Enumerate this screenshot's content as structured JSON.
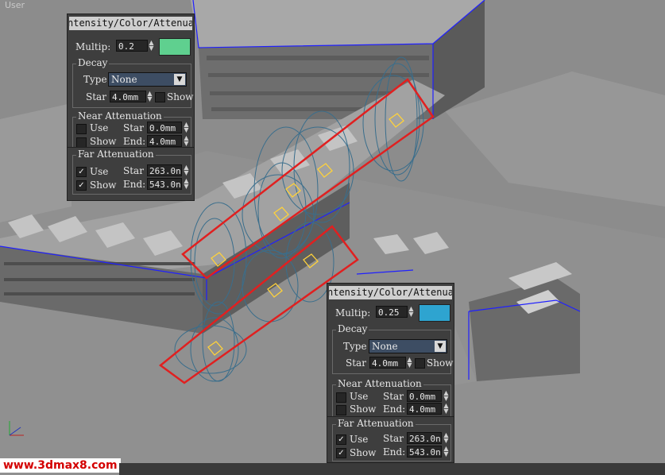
{
  "viewport": {
    "label": "User"
  },
  "watermark": "www.3dmax8.com",
  "panels": [
    {
      "title": "ntensity/Color/Attenuati",
      "multiplier_label": "Multip:",
      "multiplier": "0.2",
      "color": "#5fd08f",
      "decay": {
        "title": "Decay",
        "type_label": "Type",
        "type": "None",
        "start_label": "Star",
        "start": "4.0mm",
        "show_label": "Show",
        "show_checked": false
      },
      "near": {
        "title": "Near Attenuation",
        "use_label": "Use",
        "use_checked": false,
        "show_label": "Show",
        "show_checked": false,
        "start_label": "Star",
        "start": "0.0mm",
        "end_label": "End:",
        "end": "4.0mm"
      },
      "far": {
        "title": "Far Attenuation",
        "use_label": "Use",
        "use_checked": true,
        "show_label": "Show",
        "show_checked": true,
        "start_label": "Star",
        "start": "263.0n",
        "end_label": "End:",
        "end": "543.0n"
      }
    },
    {
      "title": "ntensity/Color/Attenuati",
      "multiplier_label": "Multip:",
      "multiplier": "0.25",
      "color": "#2ea4d0",
      "decay": {
        "title": "Decay",
        "type_label": "Type",
        "type": "None",
        "start_label": "Star",
        "start": "4.0mm",
        "show_label": "Show",
        "show_checked": false
      },
      "near": {
        "title": "Near Attenuation",
        "use_label": "Use",
        "use_checked": false,
        "show_label": "Show",
        "show_checked": false,
        "start_label": "Star",
        "start": "0.0mm",
        "end_label": "End:",
        "end": "4.0mm"
      },
      "far": {
        "title": "Far Attenuation",
        "use_label": "Use",
        "use_checked": true,
        "show_label": "Show",
        "show_checked": true,
        "start_label": "Star",
        "start": "263.0n",
        "end_label": "End:",
        "end": "543.0n"
      }
    }
  ],
  "icons": {
    "checkbox_on": "checkmark-icon",
    "dropdown": "chevron-down-icon",
    "spinner": "spinner-arrows-icon",
    "light": "omni-light-icon",
    "axis": "axis-gizmo-icon"
  },
  "colors": {
    "selection_box": "#e02020",
    "bounding_box": "#2020ff",
    "attenuation_rings": "#3a6e8c",
    "light_gizmo": "#ffd23a"
  }
}
